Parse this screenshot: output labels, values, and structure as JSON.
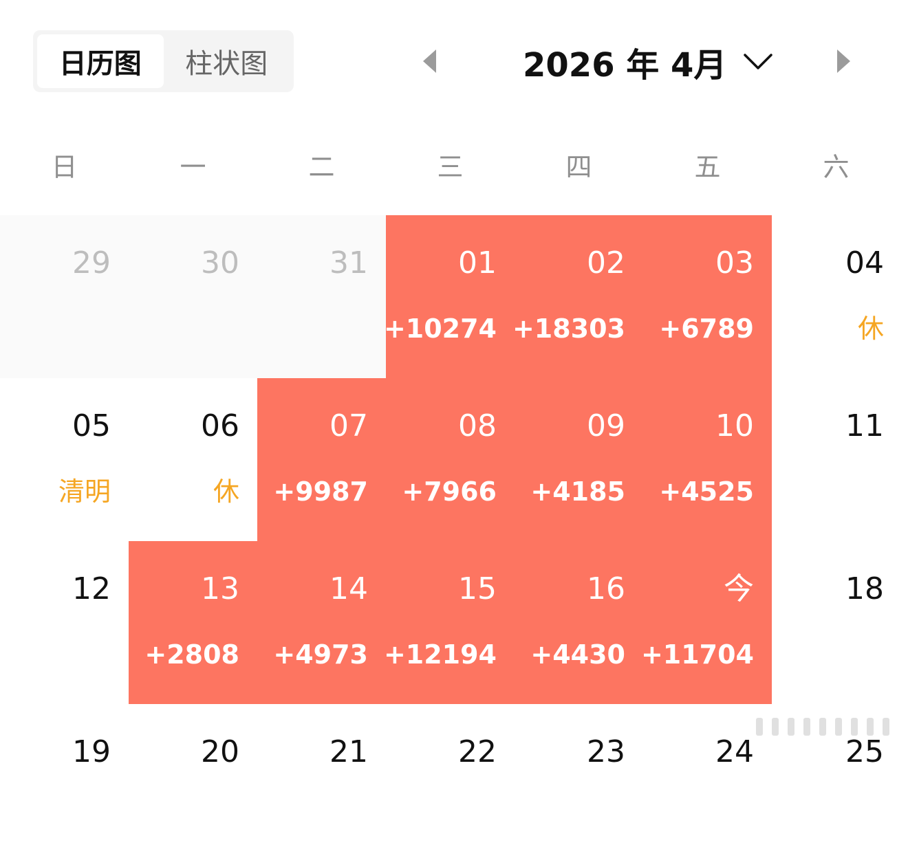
{
  "view_toggle": {
    "calendar_label": "日历图",
    "bar_label": "柱状图"
  },
  "month_header": {
    "title": "2026 年 4月"
  },
  "weekdays": [
    "日",
    "一",
    "二",
    "三",
    "四",
    "五",
    "六"
  ],
  "colors": {
    "highlight": "#fd7561",
    "holiday": "#f5a623",
    "outside_month": "#fafafa"
  },
  "weeks": [
    [
      {
        "day": "29",
        "sub": "",
        "type": "out"
      },
      {
        "day": "30",
        "sub": "",
        "type": "out"
      },
      {
        "day": "31",
        "sub": "",
        "type": "out"
      },
      {
        "day": "01",
        "sub": "+10274",
        "type": "hl"
      },
      {
        "day": "02",
        "sub": "+18303",
        "type": "hl"
      },
      {
        "day": "03",
        "sub": "+6789",
        "type": "hl"
      },
      {
        "day": "04",
        "sub": "休",
        "type": "holiday"
      }
    ],
    [
      {
        "day": "05",
        "sub": "清明",
        "type": "holiday"
      },
      {
        "day": "06",
        "sub": "休",
        "type": "holiday"
      },
      {
        "day": "07",
        "sub": "+9987",
        "type": "hl"
      },
      {
        "day": "08",
        "sub": "+7966",
        "type": "hl"
      },
      {
        "day": "09",
        "sub": "+4185",
        "type": "hl"
      },
      {
        "day": "10",
        "sub": "+4525",
        "type": "hl"
      },
      {
        "day": "11",
        "sub": "",
        "type": "normal"
      }
    ],
    [
      {
        "day": "12",
        "sub": "",
        "type": "normal"
      },
      {
        "day": "13",
        "sub": "+2808",
        "type": "hl"
      },
      {
        "day": "14",
        "sub": "+4973",
        "type": "hl"
      },
      {
        "day": "15",
        "sub": "+12194",
        "type": "hl"
      },
      {
        "day": "16",
        "sub": "+4430",
        "type": "hl"
      },
      {
        "day": "今",
        "sub": "+11704",
        "type": "hl"
      },
      {
        "day": "18",
        "sub": "",
        "type": "normal"
      }
    ],
    [
      {
        "day": "19",
        "sub": "",
        "type": "normal"
      },
      {
        "day": "20",
        "sub": "",
        "type": "normal"
      },
      {
        "day": "21",
        "sub": "",
        "type": "normal"
      },
      {
        "day": "22",
        "sub": "",
        "type": "normal"
      },
      {
        "day": "23",
        "sub": "",
        "type": "normal"
      },
      {
        "day": "24",
        "sub": "",
        "type": "normal"
      },
      {
        "day": "25",
        "sub": "",
        "type": "normal"
      }
    ]
  ]
}
